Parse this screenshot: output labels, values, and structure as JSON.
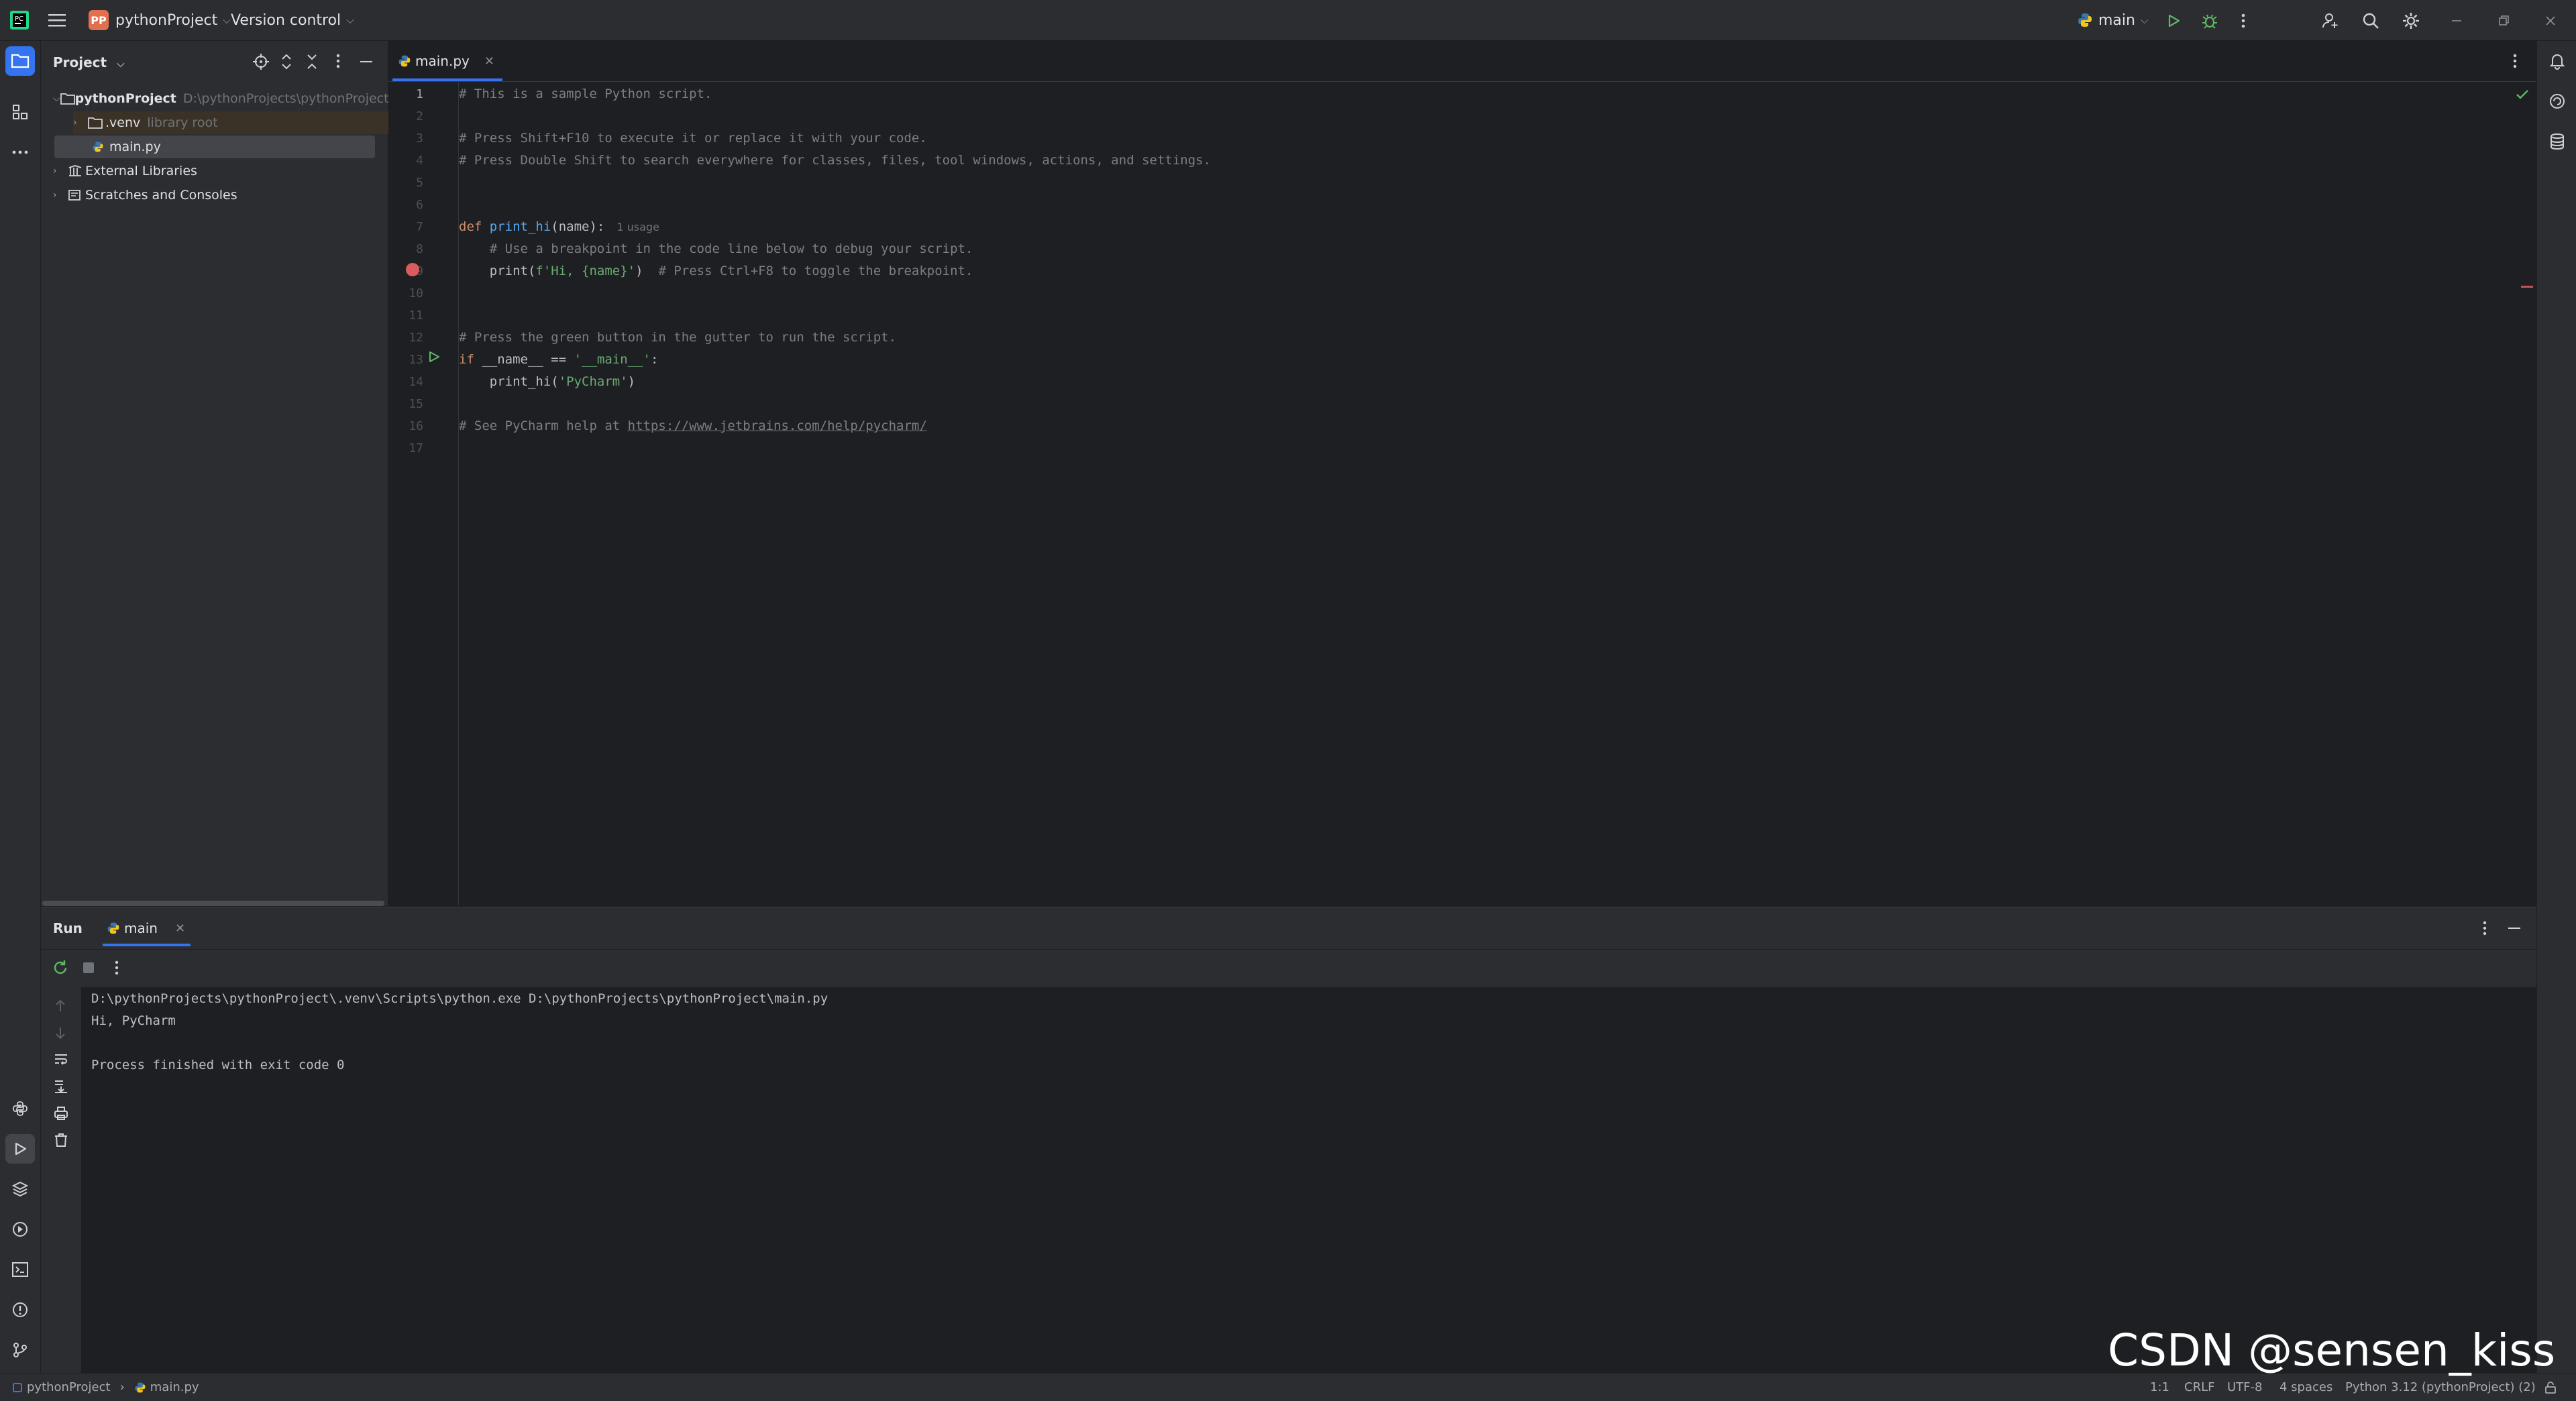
{
  "titlebar": {
    "project_badge": "PP",
    "project_name": "pythonProject",
    "vcs_label": "Version control",
    "run_config": "main"
  },
  "project_panel": {
    "title": "Project",
    "tree": [
      {
        "label": "pythonProject",
        "hint": "D:\\pythonProjects\\pythonProject"
      },
      {
        "label": ".venv",
        "hint": "library root"
      },
      {
        "label": "main.py",
        "hint": ""
      },
      {
        "label": "External Libraries",
        "hint": ""
      },
      {
        "label": "Scratches and Consoles",
        "hint": ""
      }
    ]
  },
  "editor": {
    "tab_label": "main.py",
    "line_numbers": [
      "1",
      "2",
      "3",
      "4",
      "5",
      "6",
      "7",
      "8",
      "9",
      "10",
      "11",
      "12",
      "13",
      "14",
      "15",
      "16",
      "17"
    ],
    "lines": {
      "l1": "# This is a sample Python script.",
      "l3": "# Press Shift+F10 to execute it or replace it with your code.",
      "l4": "# Press Double Shift to search everywhere for classes, files, tool windows, actions, and settings.",
      "l7_kw": "def",
      "l7_fn": "print_hi",
      "l7_rest": "(name):",
      "l7_hint": "1 usage",
      "l8": "    # Use a breakpoint in the code line below to debug your script.",
      "l9_call": "    print(",
      "l9_str": "f'Hi, {name}'",
      "l9_close": ")",
      "l9_comment": "  # Press Ctrl+F8 to toggle the breakpoint.",
      "l12": "# Press the green button in the gutter to run the script.",
      "l13_kw": "if",
      "l13_mid": " __name__ == ",
      "l13_str": "'__main__'",
      "l13_end": ":",
      "l14_call": "    print_hi(",
      "l14_str": "'PyCharm'",
      "l14_close": ")",
      "l16_prefix": "# See PyCharm help at ",
      "l16_link": "https://www.jetbrains.com/help/pycharm/"
    }
  },
  "run_panel": {
    "title": "Run",
    "tab_label": "main",
    "output": [
      "D:\\pythonProjects\\pythonProject\\.venv\\Scripts\\python.exe D:\\pythonProjects\\pythonProject\\main.py",
      "Hi, PyCharm",
      "",
      "Process finished with exit code 0"
    ]
  },
  "statusbar": {
    "breadcrumb_project": "pythonProject",
    "breadcrumb_file": "main.py",
    "position": "1:1",
    "line_sep": "CRLF",
    "encoding": "UTF-8",
    "indent": "4 spaces",
    "interpreter": "Python 3.12 (pythonProject) (2)"
  },
  "watermark": "CSDN @sensen_kiss",
  "colors": {
    "accent": "#3574f0",
    "breakpoint": "#db5c5c",
    "run_green": "#5fb865",
    "project_badge": "#e0704f"
  }
}
